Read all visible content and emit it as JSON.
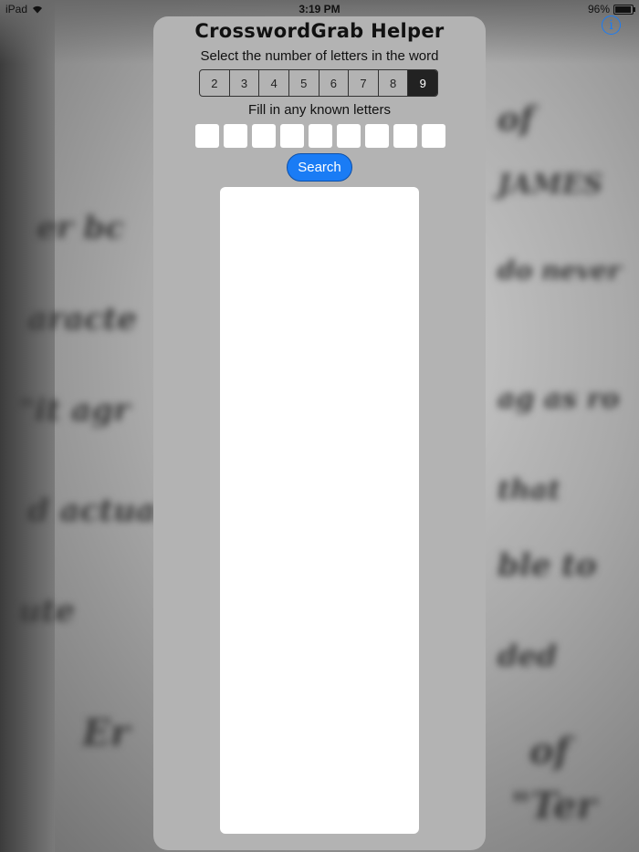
{
  "status_bar": {
    "device": "iPad",
    "time": "3:19 PM",
    "battery": "96%"
  },
  "app": {
    "title": "CrosswordGrab Helper",
    "prompt_length": "Select the number of letters in the word",
    "length_options": [
      "2",
      "3",
      "4",
      "5",
      "6",
      "7",
      "8",
      "9"
    ],
    "selected_length": "9",
    "prompt_letters": "Fill in any known letters",
    "letter_boxes": [
      "",
      "",
      "",
      "",
      "",
      "",
      "",
      "",
      ""
    ],
    "search_label": "Search",
    "info_label": "i"
  },
  "colors": {
    "accent": "#1a7cf5",
    "panel": "#b3b3b3",
    "selected_segment": "#222222"
  }
}
